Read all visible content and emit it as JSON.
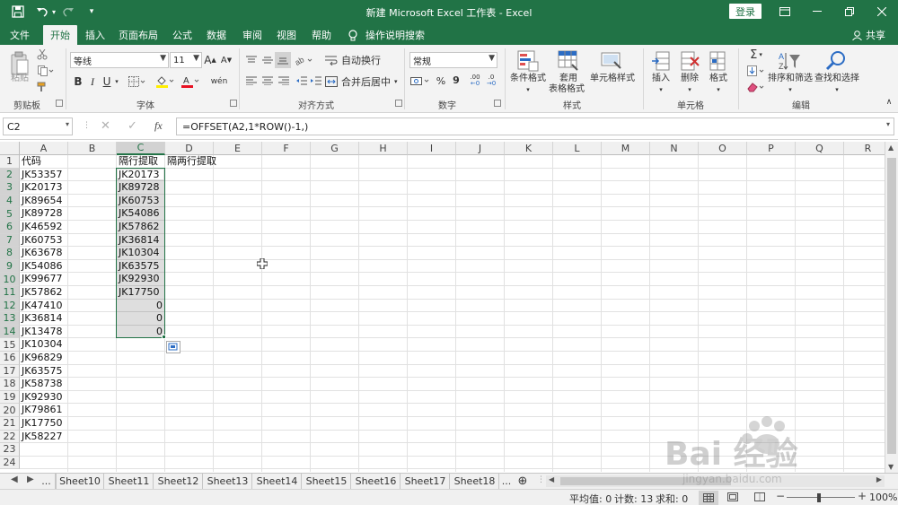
{
  "titlebar": {
    "title": "新建 Microsoft Excel 工作表 - Excel",
    "login": "登录",
    "customize_arrow": "▾"
  },
  "tabs": [
    "文件",
    "开始",
    "插入",
    "页面布局",
    "公式",
    "数据",
    "审阅",
    "视图",
    "帮助",
    "操作说明搜索"
  ],
  "share": "共享",
  "ribbon": {
    "clipboard": {
      "group": "剪贴板",
      "paste": "粘贴"
    },
    "font": {
      "group": "字体",
      "name": "等线",
      "size": "11",
      "grow": "A",
      "shrink": "A",
      "bold": "B",
      "italic": "I",
      "underline": "U",
      "phonetic": "wén",
      "font_color": "#e81123",
      "fill_color": "#ffee00"
    },
    "alignment": {
      "group": "对齐方式",
      "wrap": "自动换行",
      "merge": "合并后居中"
    },
    "number": {
      "group": "数字",
      "format": "常规",
      "percent": "%",
      "comma": "9",
      "inc_dec": ".00",
      "dec_dec": ".0"
    },
    "styles": {
      "group": "样式",
      "conditional": "条件格式",
      "table_line1": "套用",
      "table_line2": "表格格式",
      "cell_styles": "单元格样式"
    },
    "cells": {
      "group": "单元格",
      "insert": "插入",
      "delete": "删除",
      "format": "格式"
    },
    "editing": {
      "group": "编辑",
      "sort": "排序和筛选",
      "find": "查找和选择",
      "sigma": "Σ"
    }
  },
  "formula_bar": {
    "name_box": "C2",
    "cancel": "✕",
    "enter": "✓",
    "fx": "fx",
    "formula": "=OFFSET(A2,1*ROW()-1,)"
  },
  "grid": {
    "columns": [
      "A",
      "B",
      "C",
      "D",
      "E",
      "F",
      "G",
      "H",
      "I",
      "J",
      "K",
      "L",
      "M",
      "N",
      "O",
      "P",
      "Q",
      "R"
    ],
    "rows": [
      "1",
      "2",
      "3",
      "4",
      "5",
      "6",
      "7",
      "8",
      "9",
      "10",
      "11",
      "12",
      "13",
      "14",
      "15",
      "16",
      "17",
      "18",
      "19",
      "20",
      "21",
      "22",
      "23",
      "24"
    ],
    "col_a": [
      "代码",
      "JK53357",
      "JK20173",
      "JK89654",
      "JK89728",
      "JK46592",
      "JK60753",
      "JK63678",
      "JK54086",
      "JK99677",
      "JK57862",
      "JK47410",
      "JK36814",
      "JK13478",
      "JK10304",
      "JK96829",
      "JK63575",
      "JK58738",
      "JK92930",
      "JK79861",
      "JK17750",
      "JK58227"
    ],
    "col_c_header": "隔行提取",
    "col_c_text": [
      "JK20173",
      "JK89728",
      "JK60753",
      "JK54086",
      "JK57862",
      "JK36814",
      "JK10304",
      "JK63575",
      "JK92930",
      "JK17750"
    ],
    "col_c_zeros": [
      "0",
      "0",
      "0"
    ],
    "col_d_header": "隔两行提取",
    "selected_column": "C",
    "accent": "#217346"
  },
  "sheets": {
    "more": "...",
    "tabs": [
      "Sheet10",
      "Sheet11",
      "Sheet12",
      "Sheet13",
      "Sheet14",
      "Sheet15",
      "Sheet16",
      "Sheet17",
      "Sheet18"
    ],
    "more_right": "..."
  },
  "status": {
    "average": "平均值: 0",
    "count": "计数: 13",
    "sum": "求和: 0",
    "zoom": "100%",
    "minus": "−",
    "plus": "+"
  },
  "watermark": {
    "text": "Bai 经验",
    "url": "jingyan.baidu.com"
  }
}
